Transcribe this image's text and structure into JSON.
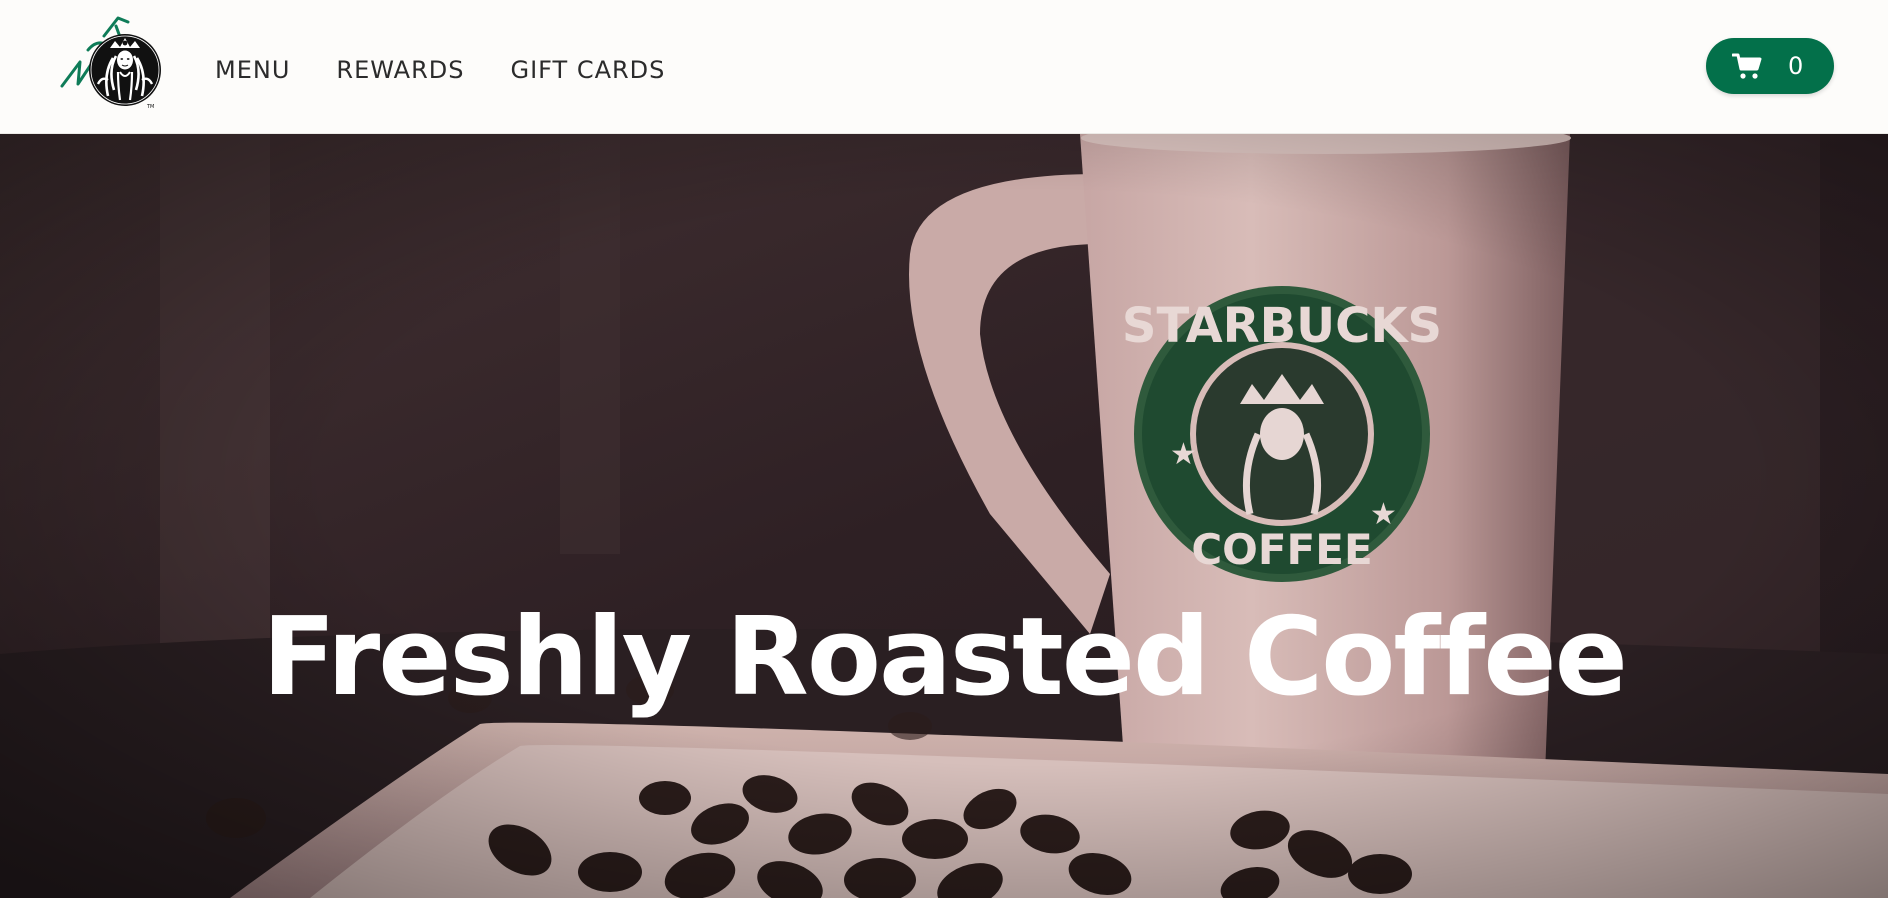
{
  "brand": {
    "logo_icon": "starbucks-siren-logo-icon",
    "accent_color": "#03704a"
  },
  "nav": {
    "items": [
      {
        "label": "MENU"
      },
      {
        "label": "REWARDS"
      },
      {
        "label": "GIFT CARDS"
      }
    ]
  },
  "cart": {
    "icon": "shopping-cart-icon",
    "count": "0"
  },
  "hero": {
    "title": "Freshly Roasted Coffee",
    "image": "starbucks-mug-coffee-beans-photo"
  }
}
